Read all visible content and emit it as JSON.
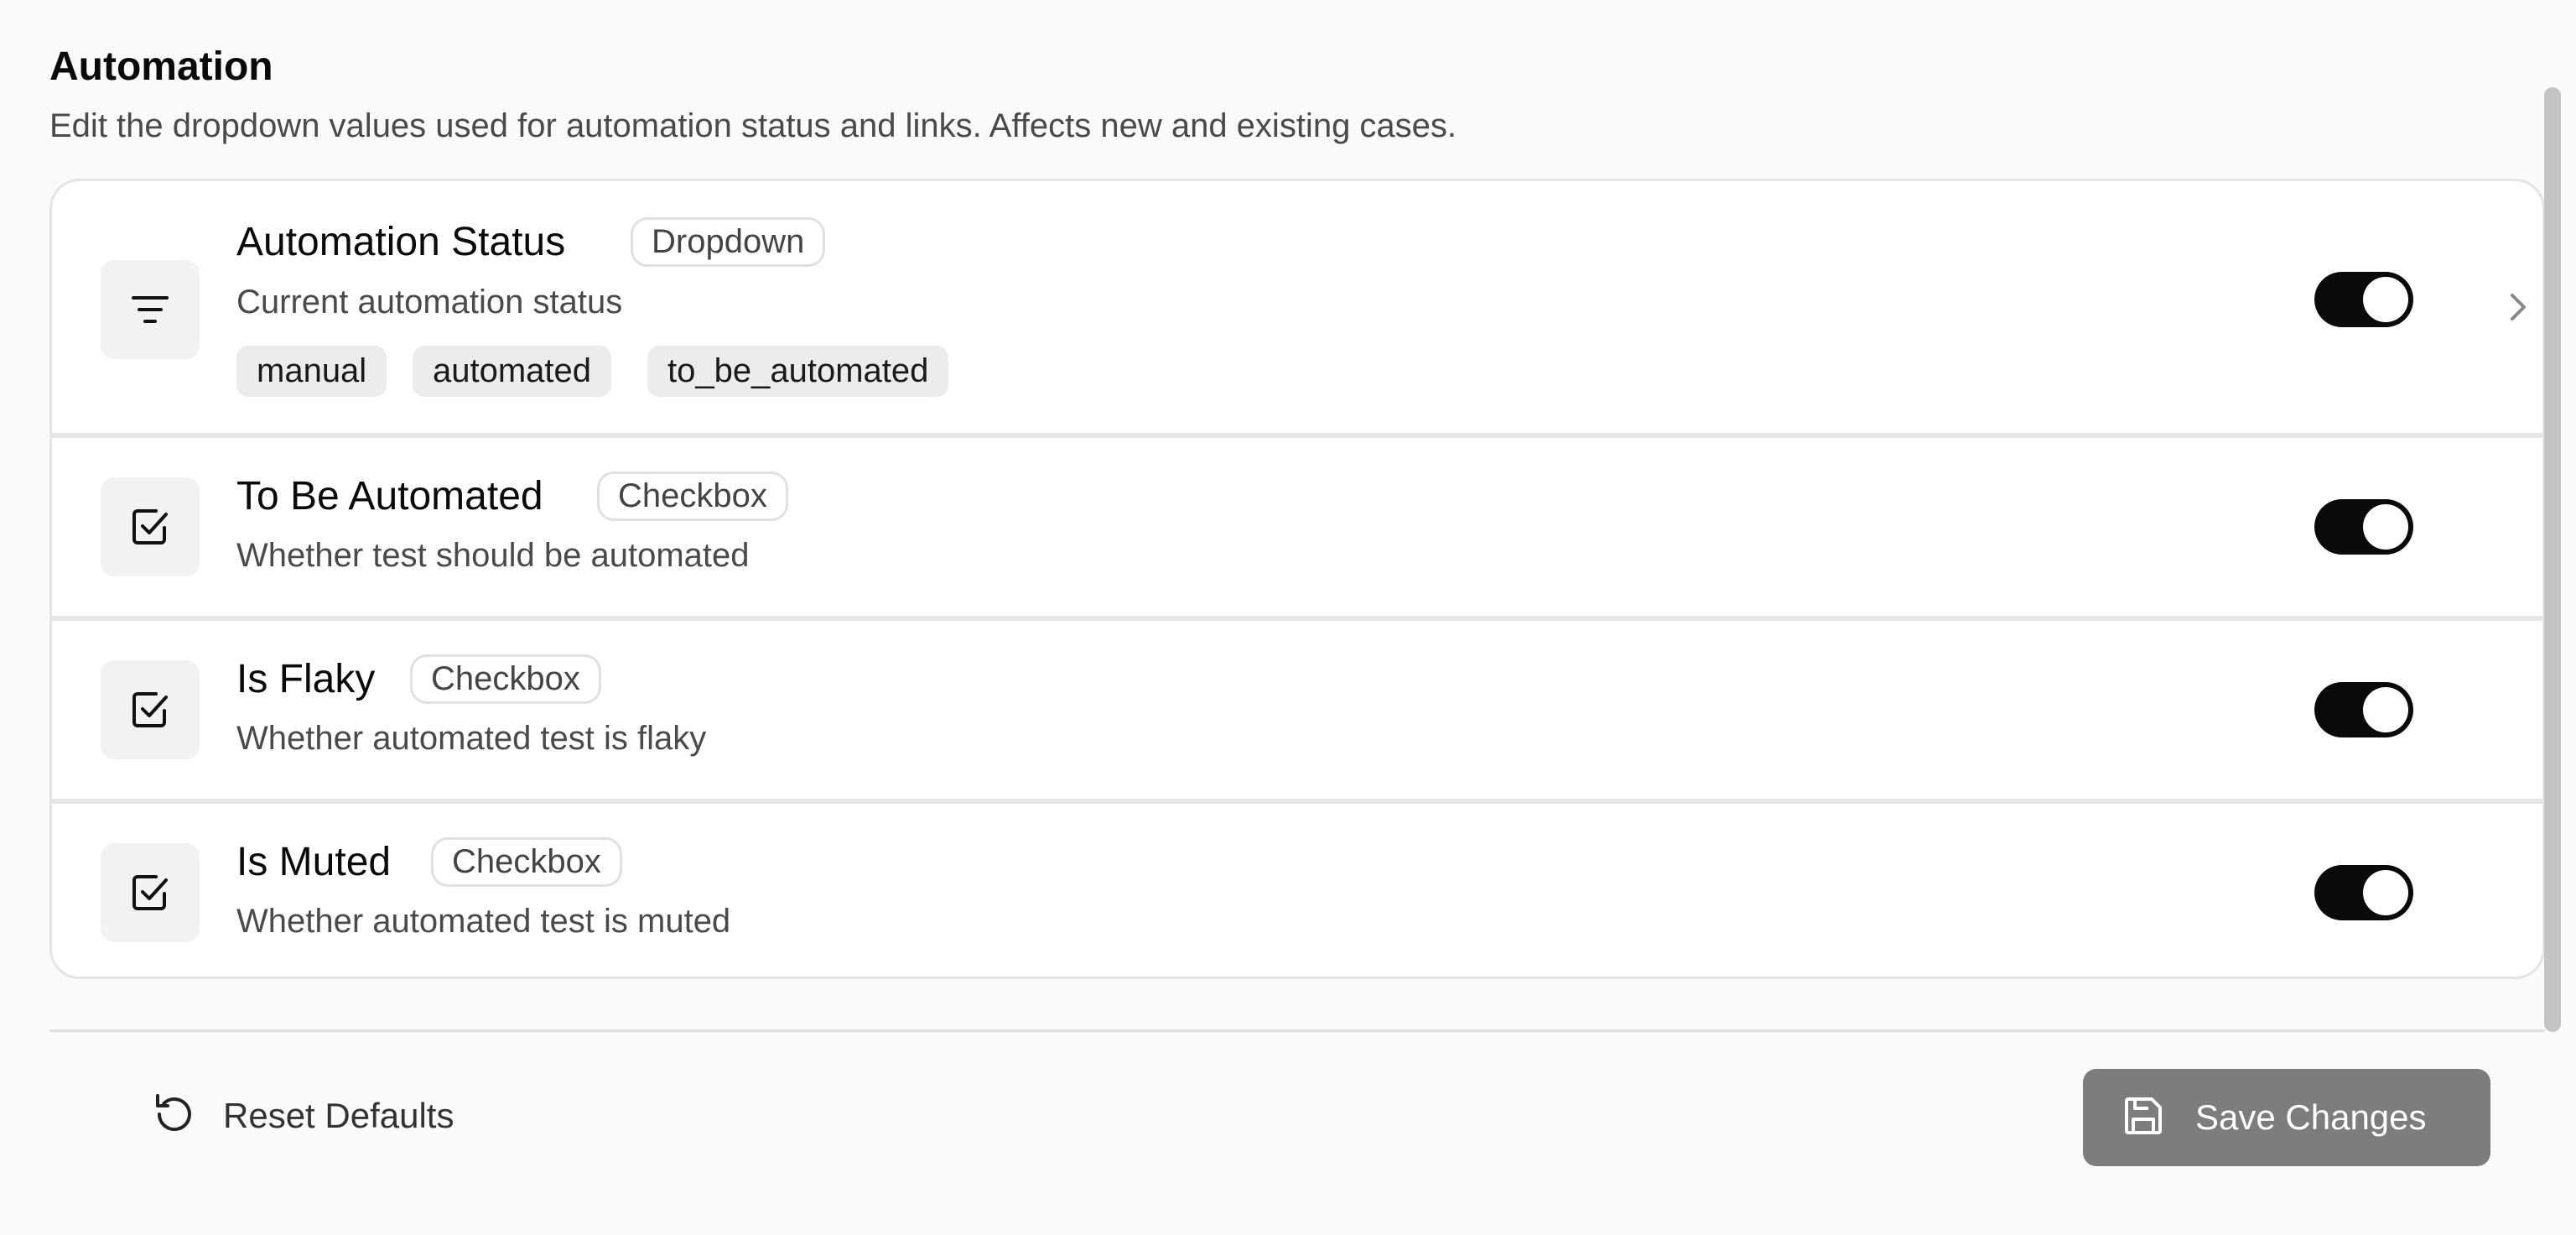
{
  "section": {
    "title": "Automation",
    "description": "Edit the dropdown values used for automation status and links. Affects new and existing cases."
  },
  "fields": [
    {
      "title": "Automation Status",
      "type": "Dropdown",
      "description": "Current automation status",
      "icon": "filter-lines-icon",
      "enabled": true,
      "options": [
        "manual",
        "automated",
        "to_be_automated"
      ]
    },
    {
      "title": "To Be Automated",
      "type": "Checkbox",
      "description": "Whether test should be automated",
      "icon": "checkbox-icon",
      "enabled": true
    },
    {
      "title": "Is Flaky",
      "type": "Checkbox",
      "description": "Whether automated test is flaky",
      "icon": "checkbox-icon",
      "enabled": true
    },
    {
      "title": "Is Muted",
      "type": "Checkbox",
      "description": "Whether automated test is muted",
      "icon": "checkbox-icon",
      "enabled": true
    }
  ],
  "footer": {
    "reset_label": "Reset Defaults",
    "save_label": "Save Changes"
  },
  "colors": {
    "toggle_on": "#0a0a0a",
    "save_button": "#7d7d7d",
    "chip_bg": "#ececec"
  }
}
